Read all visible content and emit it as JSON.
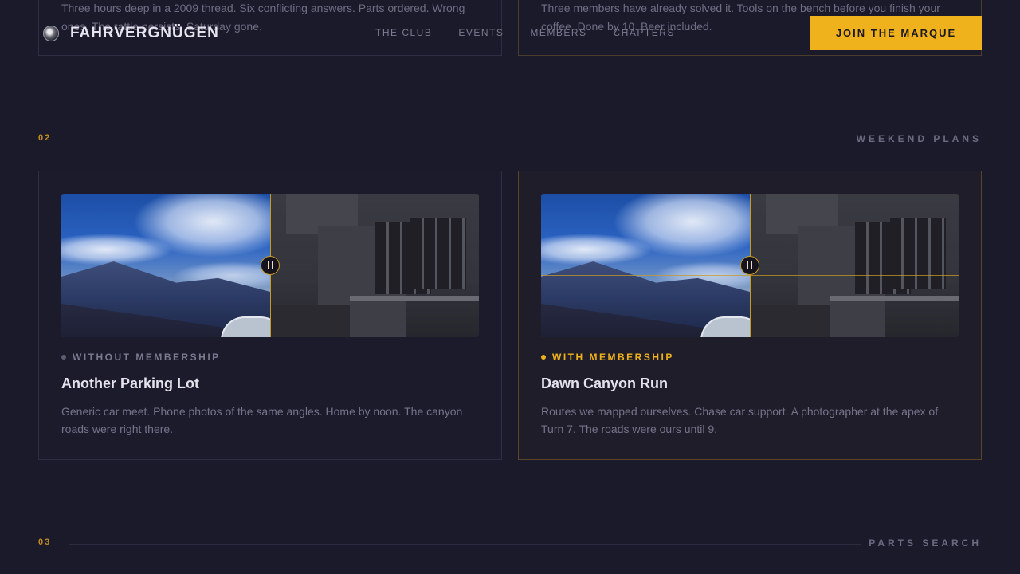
{
  "nav": {
    "brand": "FAHRVERGNÜGEN",
    "links": [
      "THE CLUB",
      "EVENTS",
      "MEMBERS",
      "CHAPTERS"
    ],
    "cta": "JOIN THE MARQUE"
  },
  "previous_section": {
    "left_text": "Three hours deep in a 2009 thread. Six conflicting answers. Parts ordered. Wrong ones. The rattle persists. Saturday gone.",
    "right_text": "Three members have already solved it. Tools on the bench before you finish your coffee. Done by 10. Beer included."
  },
  "sections": [
    {
      "number": "02",
      "title": "WEEKEND PLANS"
    },
    {
      "number": "03",
      "title": "PARTS SEARCH"
    }
  ],
  "cards": [
    {
      "tag": "WITHOUT MEMBERSHIP",
      "title": "Another Parking Lot",
      "description": "Generic car meet. Phone photos of the same angles. Home by noon. The canyon roads were right there."
    },
    {
      "tag": "WITH MEMBERSHIP",
      "title": "Dawn Canyon Run",
      "description": "Routes we mapped ourselves. Chase car support. A photographer at the apex of Turn 7. The roads were ours until 9."
    }
  ],
  "colors": {
    "background": "#1b1a2b",
    "accent": "#f0b21c"
  }
}
